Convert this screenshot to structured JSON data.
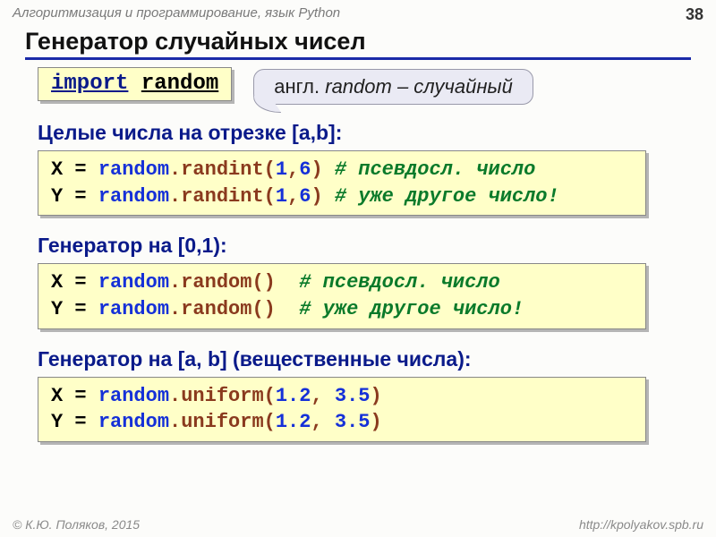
{
  "header": {
    "course": "Алгоритмизация и программирование, язык Python",
    "page": "38"
  },
  "title": "Генератор случайных чисел",
  "import_box": {
    "kw": "import",
    "mod": "random"
  },
  "bubble": {
    "prefix": "англ. ",
    "word": "random",
    "suffix": " – случайный"
  },
  "section1": {
    "label": "Целые числа на отрезке [a,b]:",
    "line1": {
      "va": "X",
      "eq": " = ",
      "mod": "random",
      "dot": ".",
      "fn": "randint",
      "lp": "(",
      "a": "1",
      "c": ",",
      "b": "6",
      "rp": ")",
      "sp": " ",
      "cm": "# псевдосл. число"
    },
    "line2": {
      "va": "Y",
      "eq": " = ",
      "mod": "random",
      "dot": ".",
      "fn": "randint",
      "lp": "(",
      "a": "1",
      "c": ",",
      "b": "6",
      "rp": ")",
      "sp": " ",
      "cm": "# уже другое число!"
    }
  },
  "section2": {
    "label": "Генератор на [0,1):",
    "line1": {
      "va": "X",
      "eq": " = ",
      "mod": "random",
      "dot": ".",
      "fn": "random",
      "lp": "(",
      "rp": ")",
      "pad": "  ",
      "cm": "# псевдосл. число"
    },
    "line2": {
      "va": "Y",
      "eq": " = ",
      "mod": "random",
      "dot": ".",
      "fn": "random",
      "lp": "(",
      "rp": ")",
      "pad": "  ",
      "cm": "# уже другое число!"
    }
  },
  "section3": {
    "label": "Генератор на [a, b] (вещественные числа):",
    "line1": {
      "va": "X",
      "eq": " = ",
      "mod": "random",
      "dot": ".",
      "fn": "uniform",
      "lp": "(",
      "a": "1.2",
      "c": ", ",
      "b": "3.5",
      "rp": ")"
    },
    "line2": {
      "va": "Y",
      "eq": " = ",
      "mod": "random",
      "dot": ".",
      "fn": "uniform",
      "lp": "(",
      "a": "1.2",
      "c": ", ",
      "b": "3.5",
      "rp": ")"
    }
  },
  "footer": {
    "left": "© К.Ю. Поляков, 2015",
    "right": "http://kpolyakov.spb.ru"
  }
}
